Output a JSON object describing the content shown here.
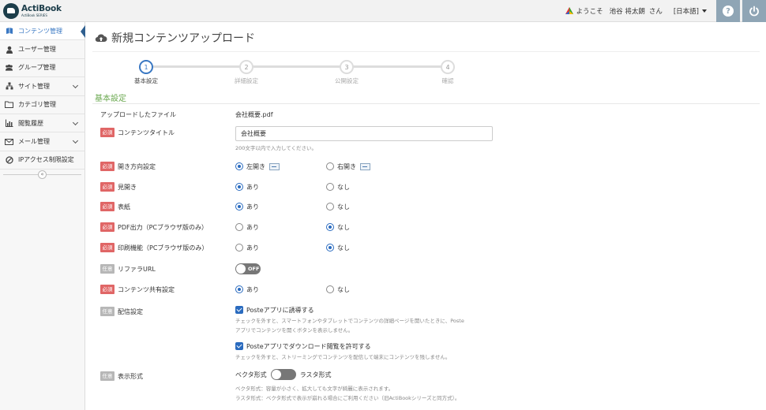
{
  "header": {
    "logo_title": "ActiBook",
    "logo_sub": "ActiBook SERIES",
    "welcome": "ようこそ",
    "user_name": "池谷 将太朗",
    "honorific": "さん",
    "language": "[日本語]",
    "help_label": "?"
  },
  "sidebar": {
    "items": [
      {
        "label": "コンテンツ管理",
        "icon": "book-icon"
      },
      {
        "label": "ユーザー管理",
        "icon": "user-icon"
      },
      {
        "label": "グループ管理",
        "icon": "group-icon"
      },
      {
        "label": "サイト管理",
        "icon": "sitemap-icon"
      },
      {
        "label": "カテゴリ管理",
        "icon": "folder-icon"
      },
      {
        "label": "閲覧履歴",
        "icon": "bar-chart-icon"
      },
      {
        "label": "メール管理",
        "icon": "mail-icon"
      },
      {
        "label": "IPアクセス制限設定",
        "icon": "ban-icon"
      }
    ],
    "collapse": "«"
  },
  "main": {
    "page_title": "新規コンテンツアップロード",
    "steps": [
      {
        "num": "1",
        "label": "基本設定"
      },
      {
        "num": "2",
        "label": "詳細設定"
      },
      {
        "num": "3",
        "label": "公開設定"
      },
      {
        "num": "4",
        "label": "確認"
      }
    ],
    "section_title": "基本設定",
    "badges": {
      "required": "必須",
      "optional": "任意"
    },
    "uploaded_file": {
      "label": "アップロードしたファイル",
      "value": "会社概要.pdf"
    },
    "content_title": {
      "label": "コンテンツタイトル",
      "value": "会社概要",
      "hint": "200文字以内で入力してください。"
    },
    "direction": {
      "label": "開き方向設定",
      "opt1": "左開き",
      "opt2": "右開き"
    },
    "spread": {
      "label": "見開き",
      "opt1": "あり",
      "opt2": "なし"
    },
    "cover": {
      "label": "表紙",
      "opt1": "あり",
      "opt2": "なし"
    },
    "pdf_output": {
      "label": "PDF出力（PCブラウザ版のみ）",
      "opt1": "あり",
      "opt2": "なし"
    },
    "print": {
      "label": "印刷機能（PCブラウザ版のみ）",
      "opt1": "あり",
      "opt2": "なし"
    },
    "referrer": {
      "label": "リファラURL",
      "toggle": "OFF"
    },
    "share": {
      "label": "コンテンツ共有設定",
      "opt1": "あり",
      "opt2": "なし"
    },
    "delivery": {
      "label": "配信設定",
      "check1": "Posteアプリに誘導する",
      "hint1a": "チェックを外すと、スマートフォンやタブレットでコンテンツの詳細ページを開いたときに、Poste",
      "hint1b": "アプリでコンテンツを開くボタンを表示しません。",
      "check2": "Posteアプリでダウンロード閲覧を許可する",
      "hint2": "チェックを外すと、ストリーミングでコンテンツを配信して端末にコンテンツを残しません。"
    },
    "display": {
      "label": "表示形式",
      "left": "ベクタ形式",
      "right": "ラスタ形式",
      "hint1": "ベクタ形式：容量が小さく、拡大しても文字が綺麗に表示されます。",
      "hint2": "ラスタ形式：ベクタ形式で表示が崩れる場合にご利用ください（旧ActiBookシリーズと同方式）。"
    }
  }
}
